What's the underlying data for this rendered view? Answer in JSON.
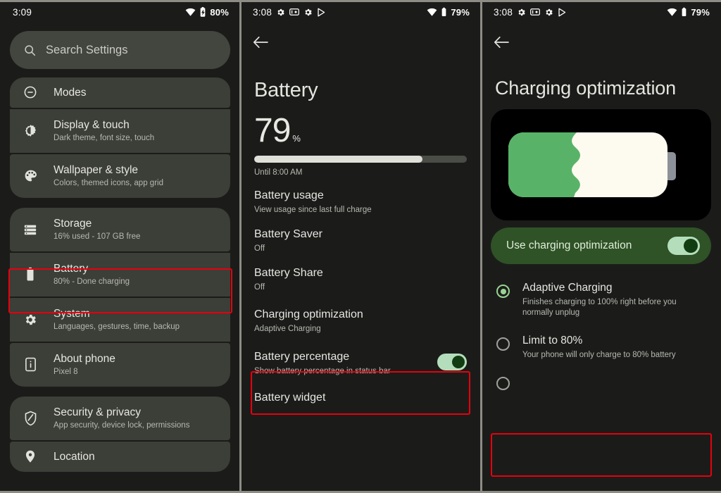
{
  "panels": {
    "settings": {
      "statusbar": {
        "time": "3:09",
        "battery_text": "80%",
        "wifi_icon": "wifi-icon",
        "battery_icon": "battery-charging-icon"
      },
      "search": {
        "placeholder": "Search Settings",
        "icon": "search-icon"
      },
      "items": [
        {
          "icon": "minus-circle-icon",
          "title": "Modes",
          "sub": ""
        },
        {
          "icon": "brightness-icon",
          "title": "Display & touch",
          "sub": "Dark theme, font size, touch"
        },
        {
          "icon": "palette-icon",
          "title": "Wallpaper & style",
          "sub": "Colors, themed icons, app grid"
        },
        {
          "icon": "storage-icon",
          "title": "Storage",
          "sub": "16% used - 107 GB free"
        },
        {
          "icon": "battery-icon",
          "title": "Battery",
          "sub": "80% - Done charging"
        },
        {
          "icon": "gear-icon",
          "title": "System",
          "sub": "Languages, gestures, time, backup"
        },
        {
          "icon": "phone-info-icon",
          "title": "About phone",
          "sub": "Pixel 8"
        },
        {
          "icon": "shield-icon",
          "title": "Security & privacy",
          "sub": "App security, device lock, permissions"
        },
        {
          "icon": "location-icon",
          "title": "Location",
          "sub": ""
        }
      ],
      "highlight_item": "Battery"
    },
    "battery": {
      "statusbar": {
        "time": "3:08",
        "battery_text": "79%",
        "icons": [
          "gear-icon",
          "screen-record-icon",
          "gear-icon",
          "play-icon"
        ]
      },
      "back_icon": "back-arrow-icon",
      "title": "Battery",
      "percent_value": "79",
      "percent_symbol": "%",
      "percent_fill": 79,
      "until": "Until 8:00 AM",
      "rows": [
        {
          "title": "Battery usage",
          "sub": "View usage since last full charge",
          "toggle": null
        },
        {
          "title": "Battery Saver",
          "sub": "Off",
          "toggle": null
        },
        {
          "title": "Battery Share",
          "sub": "Off",
          "toggle": null
        },
        {
          "title": "Charging optimization",
          "sub": "Adaptive Charging",
          "toggle": null
        },
        {
          "title": "Battery percentage",
          "sub": "Show battery percentage in status bar",
          "toggle": "on"
        },
        {
          "title": "Battery widget",
          "sub": "",
          "toggle": null
        }
      ],
      "highlight_item": "Charging optimization"
    },
    "charging": {
      "statusbar": {
        "time": "3:08",
        "battery_text": "79%",
        "icons": [
          "gear-icon",
          "screen-record-icon",
          "gear-icon",
          "play-icon"
        ]
      },
      "back_icon": "back-arrow-icon",
      "title": "Charging optimization",
      "illustration": "battery-wave-illustration",
      "banner": {
        "label": "Use charging optimization",
        "toggle": "on"
      },
      "options": [
        {
          "title": "Adaptive Charging",
          "sub": "Finishes charging to 100% right before you normally unplug",
          "selected": true
        },
        {
          "title": "Limit to 80%",
          "sub": "Your phone will only charge to 80% battery",
          "selected": false
        }
      ],
      "highlight_item": "Limit to 80%"
    }
  },
  "colors": {
    "accent_highlight": "#e8000d",
    "toggle_track": "#b4debb",
    "toggle_knob": "#123d12",
    "banner_bg": "#2f5226",
    "panel_bg": "#1b1c1a",
    "row_bg": "#3c3e38",
    "illus_green": "#58b368",
    "illus_cream": "#fdfaef"
  }
}
